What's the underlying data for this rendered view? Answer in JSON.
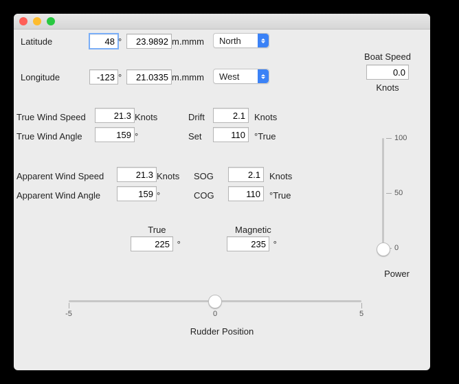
{
  "coords": {
    "lat_label": "Latitude",
    "lat_deg": "48",
    "lat_min": "23.9892",
    "lat_hemi": "North",
    "lon_label": "Longitude",
    "lon_deg": "-123",
    "lon_min": "21.0335",
    "lon_hemi": "West",
    "minutes_unit": "m.mmm",
    "deg_symbol": "°"
  },
  "boatspeed": {
    "title": "Boat Speed",
    "value": "0.0",
    "unit": "Knots"
  },
  "true_wind": {
    "speed_label": "True Wind Speed",
    "speed": "21.3",
    "speed_unit": "Knots",
    "angle_label": "True Wind Angle",
    "angle": "159",
    "angle_unit": "°"
  },
  "driftset": {
    "drift_label": "Drift",
    "drift": "2.1",
    "drift_unit": "Knots",
    "set_label": "Set",
    "set": "110",
    "set_unit": "°True"
  },
  "apparent_wind": {
    "speed_label": "Apparent Wind Speed",
    "speed": "21.3",
    "speed_unit": "Knots",
    "angle_label": "Apparent Wind Angle",
    "angle": "159",
    "angle_unit": "°"
  },
  "sogcog": {
    "sog_label": "SOG",
    "sog": "2.1",
    "sog_unit": "Knots",
    "cog_label": "COG",
    "cog": "110",
    "cog_unit": "°True"
  },
  "heading": {
    "true_label": "True",
    "true_value": "225",
    "mag_label": "Magnetic",
    "mag_value": "235",
    "unit": "°"
  },
  "power": {
    "label": "Power",
    "ticks": [
      "100",
      "50",
      "0"
    ]
  },
  "rudder": {
    "label": "Rudder Position",
    "ticks": [
      "-5",
      "0",
      "5"
    ]
  }
}
